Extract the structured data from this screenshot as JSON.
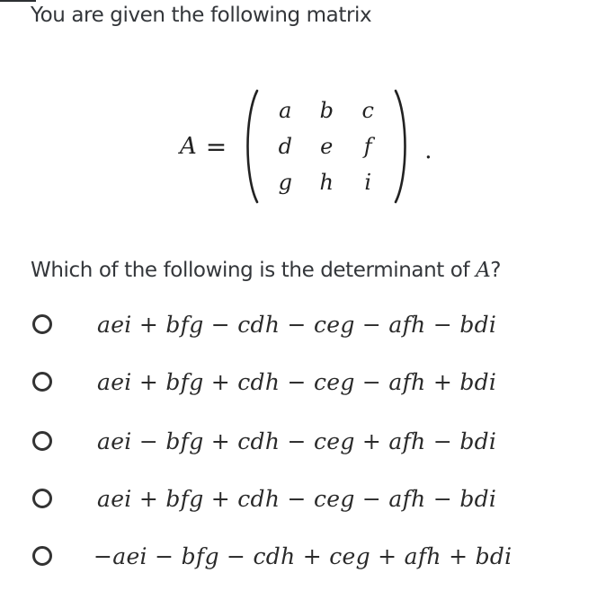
{
  "prompt": "You are given the following matrix",
  "matrix": {
    "name": "A",
    "equals": "=",
    "rows": [
      [
        "a",
        "b",
        "c"
      ],
      [
        "d",
        "e",
        "f"
      ],
      [
        "g",
        "h",
        "i"
      ]
    ],
    "trailing_punctuation": "."
  },
  "question": {
    "text_before": "Which of the following is the determinant of ",
    "variable": "A",
    "text_after": "?"
  },
  "options": [
    {
      "expression": "aei + bfg − cdh − ceg − afh − bdi",
      "selected": false
    },
    {
      "expression": "aei + bfg + cdh − ceg − afh + bdi",
      "selected": false
    },
    {
      "expression": "aei − bfg + cdh − ceg + afh − bdi",
      "selected": false
    },
    {
      "expression": "aei + bfg + cdh − ceg − afh − bdi",
      "selected": false
    },
    {
      "expression": "−aei − bfg − cdh + ceg + afh + bdi",
      "selected": false
    }
  ]
}
